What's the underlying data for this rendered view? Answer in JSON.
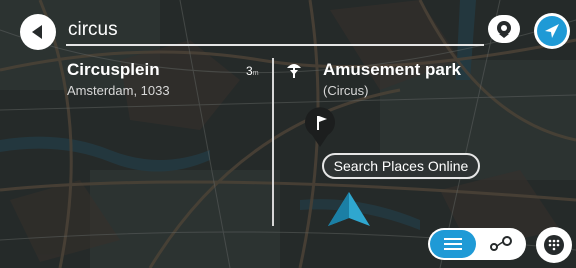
{
  "search": {
    "query": "circus"
  },
  "results": [
    {
      "title": "Circuspl­ein",
      "subtitle": "Amsterdam, 1033",
      "distance": "3",
      "unit": "m"
    },
    {
      "title": "Amusement park",
      "subtitle": "(Circus)"
    }
  ],
  "search_online_label": "Search Places Online",
  "colors": {
    "accent": "#1f9ad6",
    "panel_text": "#ffffff",
    "map_bg": "#2a2f2d"
  }
}
